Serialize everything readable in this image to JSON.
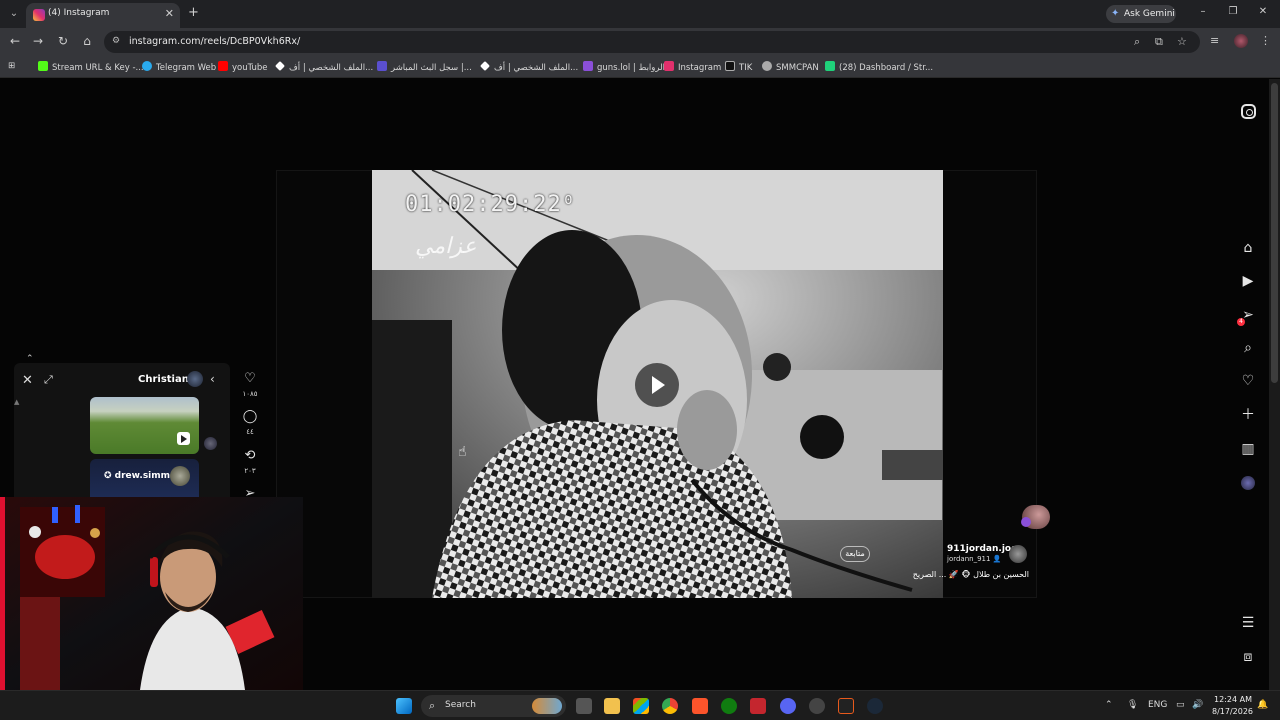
{
  "browser": {
    "tab_title": "(4) Instagram",
    "tab_close": "✕",
    "new_tab": "+",
    "ask_gemini": "Ask Gemini",
    "url": "instagram.com/reels/DcBP0Vkh6Rx/",
    "window_controls": [
      "–",
      "❐",
      "✕"
    ]
  },
  "bookmarks": [
    {
      "label": "Stream URL & Key -...",
      "color": "#53fc18"
    },
    {
      "label": "Telegram Web",
      "color": "#2aabee"
    },
    {
      "label": "youTube",
      "color": "#ff0000"
    },
    {
      "label": "الملف الشخصي | أف...",
      "color": "#ffffff"
    },
    {
      "label": "سجل البث المباشر |...",
      "color": "#5a4fcf"
    },
    {
      "label": "الملف الشخصي | أف...",
      "color": "#ffffff"
    },
    {
      "label": "guns.lol | الروابط",
      "color": "#8a4fd8"
    },
    {
      "label": "Instagram",
      "color": "#e1306c"
    },
    {
      "label": "TIK",
      "color": "#111111"
    },
    {
      "label": "SMMCPAN",
      "color": "#aaaaaa"
    },
    {
      "label": "(28) Dashboard / Str...",
      "color": "#1fd17a"
    }
  ],
  "reel": {
    "timecode": "01:02:29:22⁰",
    "watermark": "عزامي",
    "follow_label": "متابعة",
    "username": "911jordan.joo",
    "handle": "jordann_911 👤",
    "caption": "الحسين بن طلال 🐵 🚀 ... الصريح"
  },
  "messages_panel": {
    "contact_name": "Christian",
    "shared_post_user": "✪ drew.simms"
  },
  "reel_actions": {
    "likes": "١٠٨٥",
    "comments": "٤٤",
    "reposts": "٢٠٣"
  },
  "taskbar": {
    "search_placeholder": "Search",
    "language": "ENG",
    "time": "12:24 AM",
    "date": "8/17/2026"
  },
  "colors": {
    "instagram_accent": "#e1306c",
    "notification": "#ff3040",
    "windows_blue": "#3b8eea"
  }
}
